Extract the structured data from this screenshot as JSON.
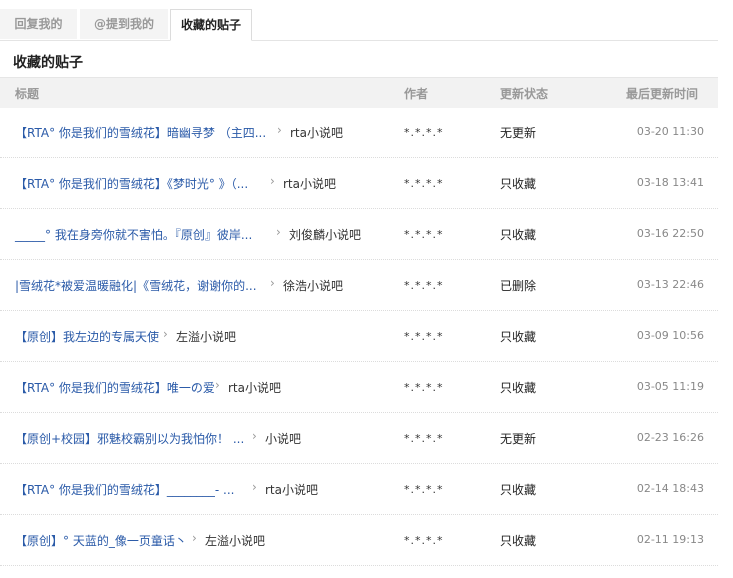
{
  "tabs": [
    {
      "label": "回复我的"
    },
    {
      "label": "@提到我的"
    },
    {
      "label": "收藏的贴子"
    }
  ],
  "section_title": "收藏的贴子",
  "columns": {
    "title": "标题",
    "author": "作者",
    "status": "更新状态",
    "time": "最后更新时间"
  },
  "sep_icon": "chevron-right-icon",
  "rows": [
    {
      "title": "【RTA° 你是我们的雪绒花】暗幽寻梦 （主四...",
      "forum": "rta小说吧",
      "author": "*.*.*.*",
      "status": "无更新",
      "time": "03-20 11:30"
    },
    {
      "title": "【RTA° 你是我们的雪绒花】《梦时光° 》（...",
      "forum": "rta小说吧",
      "author": "*.*.*.*",
      "status": "只收藏",
      "time": "03-18 13:41"
    },
    {
      "title": "_____° 我在身旁你就不害怕。『原创』彼岸...",
      "forum": "刘俊麟小说吧",
      "author": "*.*.*.*",
      "status": "只收藏",
      "time": "03-16 22:50"
    },
    {
      "title": "|雪绒花*被爱温暖融化|《雪绒花，谢谢你的...",
      "forum": "徐浩小说吧",
      "author": "*.*.*.*",
      "status": "已删除",
      "time": "03-13 22:46"
    },
    {
      "title": "【原创】我左边的专属天使",
      "forum": "左溢小说吧",
      "author": "*.*.*.*",
      "status": "只收藏",
      "time": "03-09 10:56"
    },
    {
      "title": "【RTA° 你是我们的雪绒花】唯一の爱",
      "forum": "rta小说吧",
      "author": "*.*.*.*",
      "status": "只收藏",
      "time": "03-05 11:19"
    },
    {
      "title": "【原创+校园】邪魅校霸别以为我怕你！ ...",
      "forum": "小说吧",
      "author": "*.*.*.*",
      "status": "无更新",
      "time": "02-23 16:26"
    },
    {
      "title": "【RTA° 你是我们的雪绒花】________- ...",
      "forum": "rta小说吧",
      "author": "*.*.*.*",
      "status": "只收藏",
      "time": "02-14 18:43"
    },
    {
      "title": "【原创】° 天蓝的_像一页童话丶",
      "forum": "左溢小说吧",
      "author": "*.*.*.*",
      "status": "只收藏",
      "time": "02-11 19:13"
    }
  ]
}
